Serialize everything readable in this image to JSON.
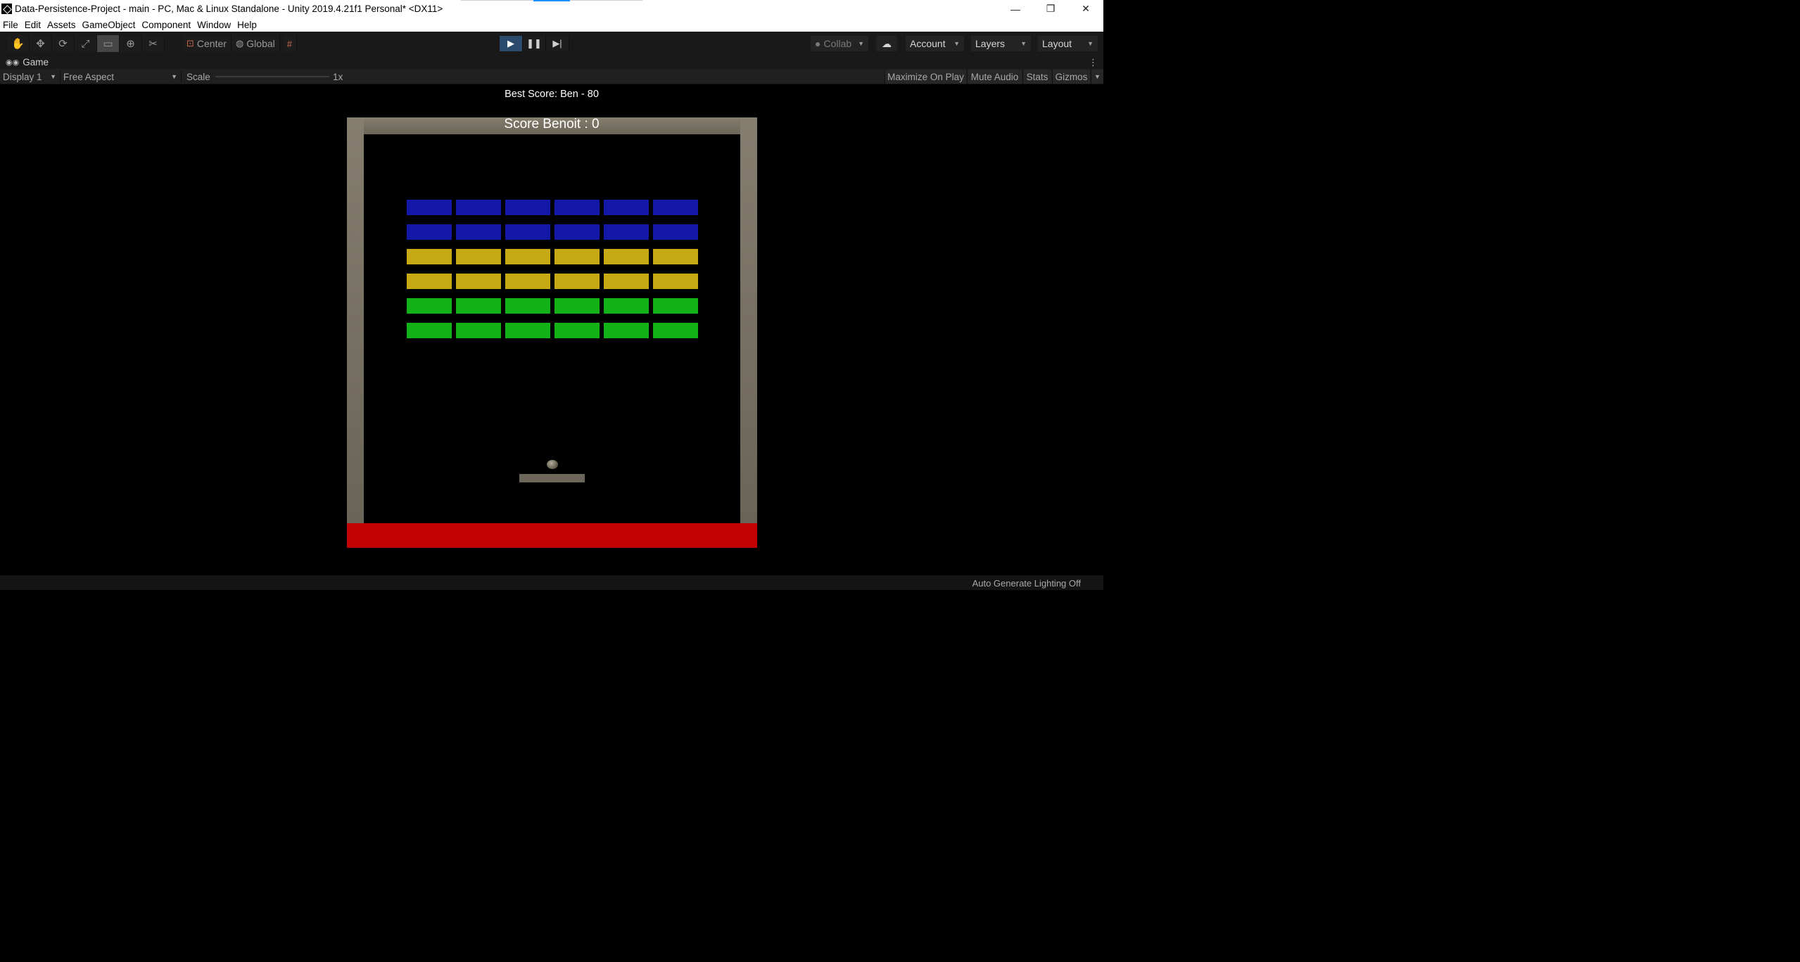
{
  "window": {
    "title": "Data-Persistence-Project - main - PC, Mac & Linux Standalone - Unity 2019.4.21f1 Personal* <DX11>",
    "controls": {
      "minimize": "—",
      "restore": "❐",
      "close": "✕"
    }
  },
  "menu": [
    "File",
    "Edit",
    "Assets",
    "GameObject",
    "Component",
    "Window",
    "Help"
  ],
  "toolbar": {
    "tools": [
      "hand-tool-icon",
      "move-tool-icon",
      "rotate-tool-icon",
      "scale-tool-icon",
      "rect-tool-icon",
      "transform-tool-icon",
      "custom-tool-icon"
    ],
    "active_tool": "rect-tool-icon",
    "pivot_mode": "Center",
    "pivot_rotation": "Global",
    "play_state": {
      "playing": true,
      "paused": false
    },
    "collab_label": "Collab",
    "account_label": "Account",
    "layers_label": "Layers",
    "layout_label": "Layout"
  },
  "game_tab": {
    "label": "Game"
  },
  "game_bar": {
    "display": "Display 1",
    "aspect": "Free Aspect",
    "scale_label": "Scale",
    "scale_value": "1x",
    "maximize_on_play": "Maximize On Play",
    "mute_audio": "Mute Audio",
    "stats": "Stats",
    "gizmos": "Gizmos"
  },
  "game": {
    "best_score": "Best Score: Ben - 80",
    "score": "Score Benoit : 0",
    "brick_rows": [
      "blue",
      "blue",
      "yellow",
      "yellow",
      "green",
      "green"
    ],
    "bricks_per_row": 6,
    "colors": {
      "blue": "#1418a8",
      "yellow": "#c6a914",
      "green": "#13b317",
      "wall": "#7a7466",
      "death_zone": "#c20202",
      "paddle": "#6d675b"
    }
  },
  "status": {
    "lighting": "Auto Generate Lighting Off"
  }
}
